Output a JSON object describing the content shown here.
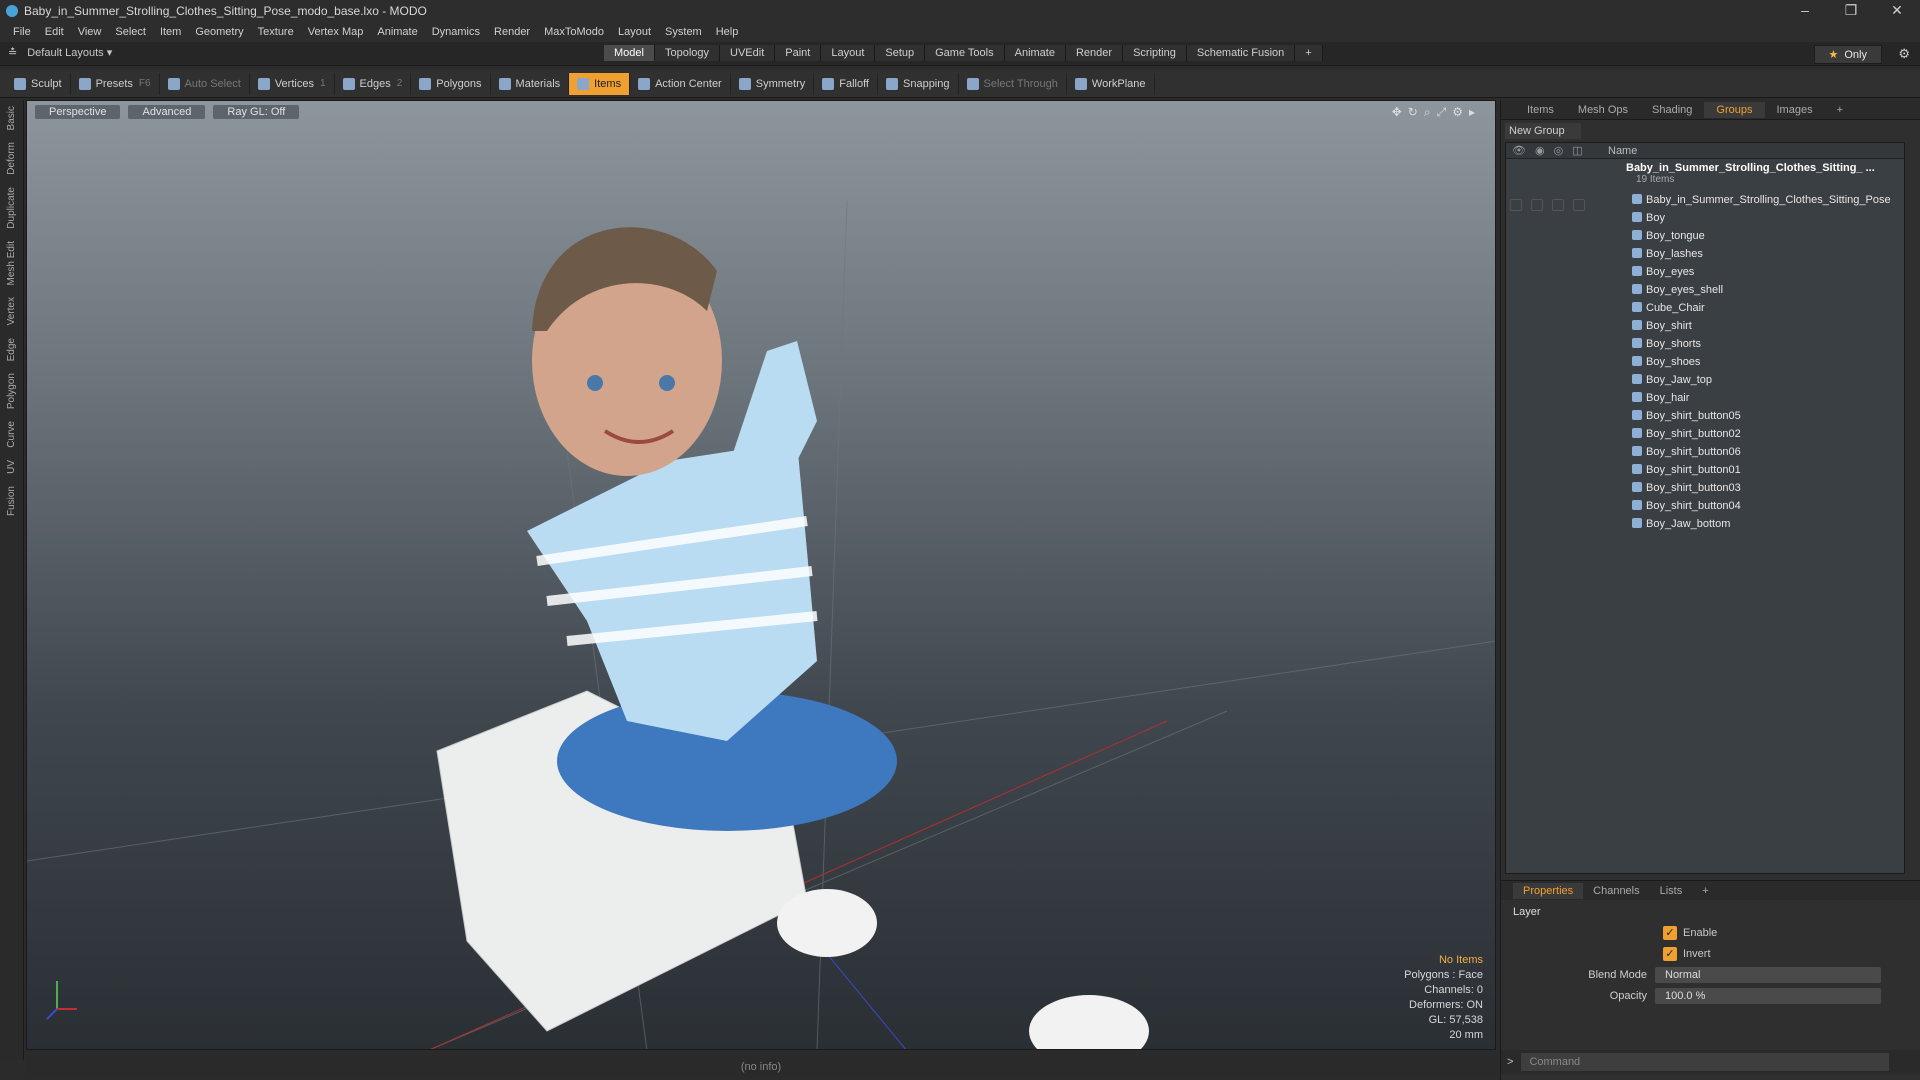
{
  "window": {
    "title": "Baby_in_Summer_Strolling_Clothes_Sitting_Pose_modo_base.lxo - MODO"
  },
  "menu": [
    "File",
    "Edit",
    "View",
    "Select",
    "Item",
    "Geometry",
    "Texture",
    "Vertex Map",
    "Animate",
    "Dynamics",
    "Render",
    "MaxToModo",
    "Layout",
    "System",
    "Help"
  ],
  "layout": {
    "label": "Default Layouts",
    "only": "Only"
  },
  "mode_tabs": [
    "Model",
    "Topology",
    "UVEdit",
    "Paint",
    "Layout",
    "Setup",
    "Game Tools",
    "Animate",
    "Render",
    "Scripting",
    "Schematic Fusion"
  ],
  "toolbar": {
    "sculpt": "Sculpt",
    "presets": "Presets",
    "presets_key": "F6",
    "auto_select": "Auto Select",
    "vertices": "Vertices",
    "vertices_key": "1",
    "edges": "Edges",
    "edges_key": "2",
    "polygons": "Polygons",
    "materials": "Materials",
    "items": "Items",
    "action_center": "Action Center",
    "symmetry": "Symmetry",
    "falloff": "Falloff",
    "snapping": "Snapping",
    "select_through": "Select Through",
    "workplane": "WorkPlane"
  },
  "left_tabs": [
    "Basic",
    "Deform",
    "Duplicate",
    "Mesh Edit",
    "Vertex",
    "Edge",
    "Polygon",
    "Curve",
    "UV",
    "Fusion"
  ],
  "viewport": {
    "view": "Perspective",
    "shading": "Advanced",
    "raygl": "Ray GL: Off",
    "stats": {
      "items": "No Items",
      "polygons": "Polygons : Face",
      "channels": "Channels: 0",
      "deformers": "Deformers: ON",
      "gl": "GL: 57,538",
      "scale": "20 mm"
    }
  },
  "status": "(no info)",
  "right_tabs": [
    "Items",
    "Mesh Ops",
    "Shading",
    "Groups",
    "Images"
  ],
  "groups": {
    "new_group": "New Group",
    "name_header": "Name",
    "root": "Baby_in_Summer_Strolling_Clothes_Sitting_ ...",
    "root_sub": "19 Items",
    "items": [
      "Baby_in_Summer_Strolling_Clothes_Sitting_Pose",
      "Boy",
      "Boy_tongue",
      "Boy_lashes",
      "Boy_eyes",
      "Boy_eyes_shell",
      "Cube_Chair",
      "Boy_shirt",
      "Boy_shorts",
      "Boy_shoes",
      "Boy_Jaw_top",
      "Boy_hair",
      "Boy_shirt_button05",
      "Boy_shirt_button02",
      "Boy_shirt_button06",
      "Boy_shirt_button01",
      "Boy_shirt_button03",
      "Boy_shirt_button04",
      "Boy_Jaw_bottom"
    ]
  },
  "prop_tabs": [
    "Properties",
    "Channels",
    "Lists"
  ],
  "properties": {
    "section": "Layer",
    "enable": "Enable",
    "invert": "Invert",
    "blend_label": "Blend Mode",
    "blend_value": "Normal",
    "opacity_label": "Opacity",
    "opacity_value": "100.0 %"
  },
  "command": {
    "placeholder": "Command"
  }
}
